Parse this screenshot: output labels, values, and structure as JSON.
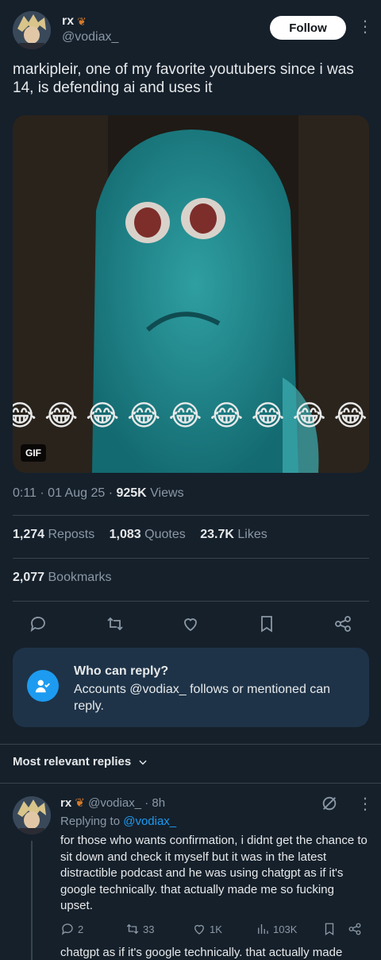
{
  "tweet": {
    "author_name": "rx",
    "author_handle": "@vodiax_",
    "follow_label": "Follow",
    "text": "markipleir, one of my favorite youtubers since i was 14, is defending ai and uses it",
    "media_badge": "GIF",
    "time": "0:11",
    "date": "01 Aug 25",
    "views_value": "925K",
    "views_label": "Views"
  },
  "stats": {
    "reposts_value": "1,274",
    "reposts_label": "Reposts",
    "quotes_value": "1,083",
    "quotes_label": "Quotes",
    "likes_value": "23.7K",
    "likes_label": "Likes",
    "bookmarks_value": "2,077",
    "bookmarks_label": "Bookmarks"
  },
  "reply_restriction": {
    "title": "Who can reply?",
    "description": "Accounts @vodiax_ follows or mentioned can reply."
  },
  "replies_section": {
    "heading": "Most relevant replies"
  },
  "reply": {
    "author_name": "rx",
    "author_handle": "@vodiax_",
    "age": "· 8h",
    "replying_prefix": "Replying to",
    "replying_handle": "@vodiax_",
    "text": "for those who wants confirmation, i didnt get the chance to sit down and check it myself but it was in the latest distractible podcast and he was using chatgpt as if it's google technically. that actually made me so fucking upset.",
    "replies_count": "2",
    "reposts_count": "33",
    "likes_count": "1K",
    "views_count": "103K",
    "next_preview": "chatgpt as if it's google technically. that actually made"
  },
  "colors": {
    "background": "#15202b",
    "accent": "#1d9bf0",
    "muted": "#8b98a5",
    "card": "#1e3348"
  },
  "icons": [
    "avatar",
    "leaf-emoji",
    "kebab-icon",
    "reply-icon",
    "repost-icon",
    "like-icon",
    "bookmark-icon",
    "share-icon",
    "person-check-icon",
    "chevron-down-icon",
    "grok-icon",
    "views-icon"
  ]
}
